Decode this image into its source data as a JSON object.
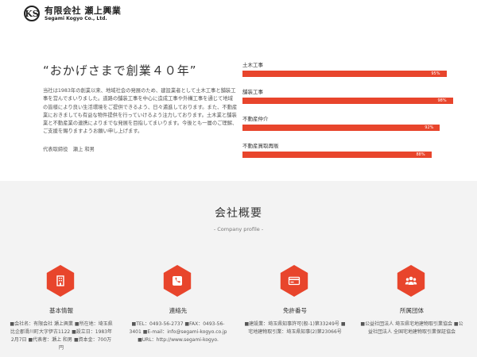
{
  "header": {
    "logo_mark": "KS",
    "company_jp": "有限会社 瀬上興業",
    "company_en": "Segami Kogyo Co., Ltd."
  },
  "intro": {
    "tagline": "“おかげさまで創業４０年”",
    "message": "当社は1983年の創業以来、地域社会の発展のため、建設業者として土木工事と舗装工事を営んでまいりました。道路の舗装工事を中心に造成工事や外構工事を通じて地域の皆様により良い生活環境をご提供できるよう、日々邁進しております。また、不動産業におきましても有益な物件提供を行っていけるよう注力しております。土木業と舗装業と不動産業の連携によりまでな発展を目指してまいります。今後とも一層のご理解、ご支援を賜りますようお願い申し上げます。",
    "signature": "代表取締役　瀬上 和男"
  },
  "skills": [
    {
      "label": "土木工事",
      "percent": 95,
      "value_text": "95%"
    },
    {
      "label": "舗装工事",
      "percent": 98,
      "value_text": "98%"
    },
    {
      "label": "不動産仲介",
      "percent": 92,
      "value_text": "92%"
    },
    {
      "label": "不動産買取再販",
      "percent": 88,
      "value_text": "88%"
    }
  ],
  "profile": {
    "title": "会社概要",
    "subtitle": "- Company profile -",
    "cards": [
      {
        "icon": "building-icon",
        "title": "基本情報",
        "body": "■会社名：有限会社 瀬上興業 ■所在地：埼玉県比企郡滑川町大字伊古1122 ■設立日：1983年2月7日 ■代表者：瀬上 和男 ■資本金：700万円"
      },
      {
        "icon": "phone-icon",
        "title": "連絡先",
        "body": "■TEL：0493-56-2737 ■FAX：0493-56-3401 ■E-mail：info@segami-kogyo.co.jp ■URL：http://www.segami-kogyo."
      },
      {
        "icon": "license-card-icon",
        "title": "免許番号",
        "body": "■建設業：埼玉県知事許可(般-1)第33249号 ■宅地建物取引業：埼玉県知事(2)第23066号"
      },
      {
        "icon": "group-icon",
        "title": "所属団体",
        "body": "■公益社団法人 埼玉県宅地建物取引業協会 ■公益社団法人 全国宅地建物取引業保証協会"
      }
    ]
  },
  "colors": {
    "accent": "#e8452c",
    "section_bg": "#f3f3f3"
  }
}
